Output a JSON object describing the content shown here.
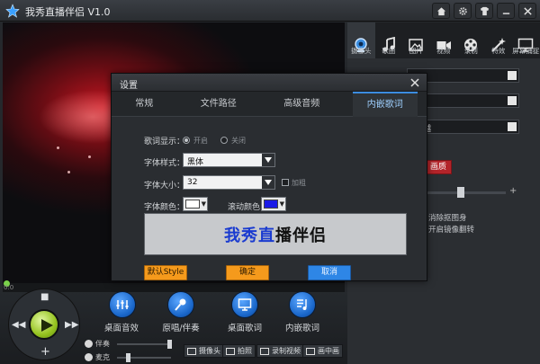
{
  "window": {
    "title": "我秀直播伴侣 V1.0"
  },
  "preview": {
    "time": "0:0"
  },
  "tool_tabs": [
    {
      "label": "摄像头",
      "icon": "webcam-icon",
      "active": true
    },
    {
      "label": "歌曲",
      "icon": "music-note-icon",
      "active": false
    },
    {
      "label": "图片",
      "icon": "picture-icon",
      "active": false
    },
    {
      "label": "视频",
      "icon": "video-camera-icon",
      "active": false
    },
    {
      "label": "录制",
      "icon": "film-reel-icon",
      "active": false
    },
    {
      "label": "特效",
      "icon": "magic-wand-icon",
      "active": false
    },
    {
      "label": "屏幕捕捉",
      "icon": "monitor-icon",
      "active": false
    }
  ],
  "right_panel": {
    "select_3_value": "越",
    "red_button": "画质",
    "text_1": "消除抠图身",
    "text_2": "开启镜像翻转"
  },
  "bottom": {
    "functions": [
      "桌面音效",
      "原唱/伴奏",
      "桌面歌词",
      "内嵌歌词"
    ],
    "volume": [
      {
        "label": "伴奏"
      },
      {
        "label": "麦克"
      }
    ],
    "buttons": [
      "摄像头",
      "拍照",
      "录制视频",
      "画中画"
    ]
  },
  "dialog": {
    "title": "设置",
    "tabs": [
      {
        "label": "常规",
        "active": false
      },
      {
        "label": "文件路径",
        "active": false
      },
      {
        "label": "高级音频",
        "active": false
      },
      {
        "label": "内嵌歌词",
        "active": true
      }
    ],
    "lyrics_display_label": "歌词显示：",
    "option_on": "开启",
    "option_off": "关闭",
    "font_style_label": "字体样式：",
    "font_style_value": "黑体",
    "font_size_label": "字体大小：",
    "font_size_value": "32",
    "bold_label": "加粗",
    "font_color_label": "字体颜色：",
    "scroll_color_label": "滚动颜色：",
    "font_color": "#ffffff",
    "scroll_color": "#1a1ae6",
    "preview_sung": "我秀直",
    "preview_rest": "播伴侣",
    "btn_default": "默认Style",
    "btn_ok": "确定",
    "btn_cancel": "取消"
  }
}
